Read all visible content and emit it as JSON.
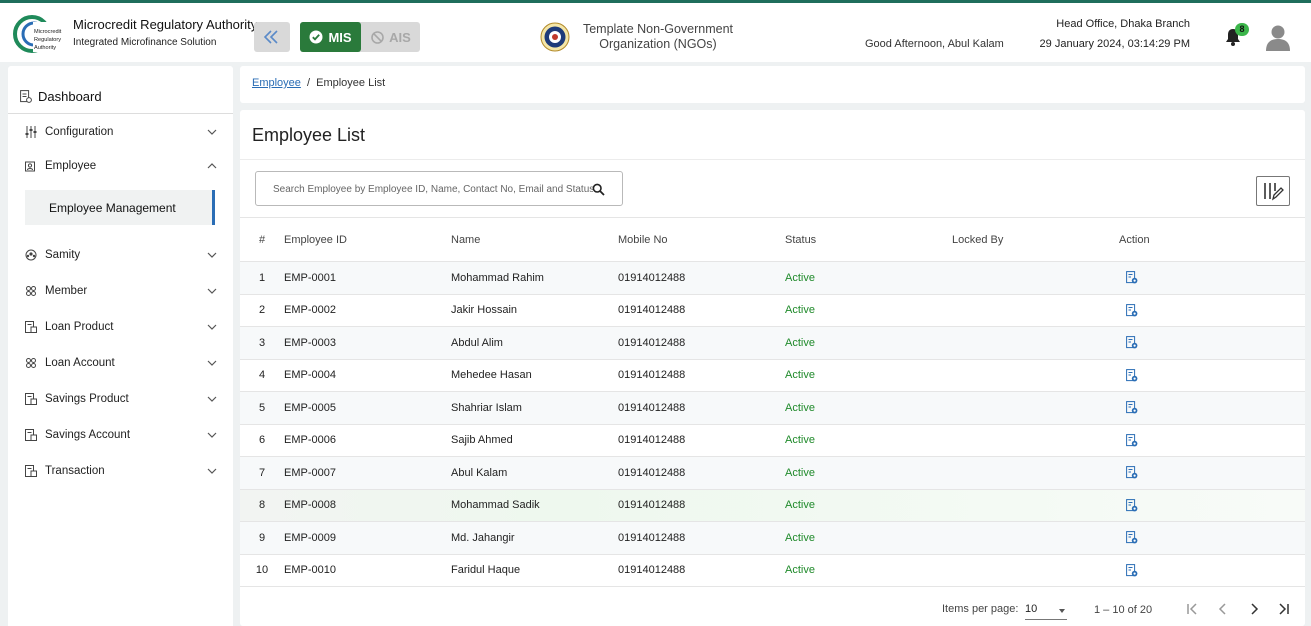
{
  "header": {
    "logo_text": [
      "Microcredit",
      "Regulatory",
      "Authority"
    ],
    "brand_title": "Microcredit Regulatory Authority",
    "brand_subtitle": "Integrated Microfinance Solution",
    "modules": {
      "mis": "MIS",
      "ais": "AIS",
      "active": "MIS"
    },
    "org_line1": "Template Non-Government",
    "org_line2": "Organization (NGOs)",
    "greeting": "Good Afternoon, Abul Kalam",
    "branch": "Head Office, Dhaka Branch",
    "datetime": "29 January 2024, 03:14:29 PM",
    "notification_count": "8",
    "accent_color": "#1f6e5c",
    "icons": [
      "collapse-sidebar-icon",
      "check-circle-icon",
      "ban-icon",
      "org-seal-icon",
      "bell-icon",
      "user-avatar-icon"
    ]
  },
  "sidebar": {
    "dashboard": "Dashboard",
    "items": [
      {
        "label": "Configuration",
        "icon": "sliders-icon",
        "expanded": false
      },
      {
        "label": "Employee",
        "icon": "employee-icon",
        "expanded": true
      },
      {
        "label": "Samity",
        "icon": "group-icon",
        "expanded": false
      },
      {
        "label": "Member",
        "icon": "members-icon",
        "expanded": false
      },
      {
        "label": "Loan Product",
        "icon": "document-icon",
        "expanded": false
      },
      {
        "label": "Loan Account",
        "icon": "members-icon",
        "expanded": false
      },
      {
        "label": "Savings Product",
        "icon": "document-icon",
        "expanded": false
      },
      {
        "label": "Savings Account",
        "icon": "document-icon",
        "expanded": false
      },
      {
        "label": "Transaction",
        "icon": "document-icon",
        "expanded": false
      }
    ],
    "sub_item": "Employee Management"
  },
  "breadcrumb": {
    "parent": "Employee",
    "separator": "/",
    "current": "Employee List"
  },
  "main": {
    "title": "Employee List",
    "search_placeholder": "Search Employee by Employee ID, Name, Contact No, Email and Status",
    "table": {
      "columns": [
        "#",
        "Employee ID",
        "Name",
        "Mobile No",
        "Status",
        "Locked By",
        "Action"
      ],
      "rows": [
        {
          "num": "1",
          "id": "EMP-0001",
          "name": "Mohammad Rahim",
          "mobile": "01914012488",
          "status": "Active",
          "locked_by": ""
        },
        {
          "num": "2",
          "id": "EMP-0002",
          "name": "Jakir Hossain",
          "mobile": "01914012488",
          "status": "Active",
          "locked_by": ""
        },
        {
          "num": "3",
          "id": "EMP-0003",
          "name": "Abdul Alim",
          "mobile": "01914012488",
          "status": "Active",
          "locked_by": ""
        },
        {
          "num": "4",
          "id": "EMP-0004",
          "name": "Mehedee Hasan",
          "mobile": "01914012488",
          "status": "Active",
          "locked_by": ""
        },
        {
          "num": "5",
          "id": "EMP-0005",
          "name": "Shahriar Islam",
          "mobile": "01914012488",
          "status": "Active",
          "locked_by": ""
        },
        {
          "num": "6",
          "id": "EMP-0006",
          "name": "Sajib Ahmed",
          "mobile": "01914012488",
          "status": "Active",
          "locked_by": ""
        },
        {
          "num": "7",
          "id": "EMP-0007",
          "name": "Abul Kalam",
          "mobile": "01914012488",
          "status": "Active",
          "locked_by": ""
        },
        {
          "num": "8",
          "id": "EMP-0008",
          "name": "Mohammad Sadik",
          "mobile": "01914012488",
          "status": "Active",
          "locked_by": ""
        },
        {
          "num": "9",
          "id": "EMP-0009",
          "name": "Md. Jahangir",
          "mobile": "01914012488",
          "status": "Active",
          "locked_by": ""
        },
        {
          "num": "10",
          "id": "EMP-0010",
          "name": "Faridul Haque",
          "mobile": "01914012488",
          "status": "Active",
          "locked_by": ""
        }
      ]
    },
    "pagination": {
      "items_per_page_label": "Items per page:",
      "items_per_page": "10",
      "range": "1 – 10 of 20"
    },
    "status_color": "#1f8a2a",
    "link_color": "#2a6db5"
  }
}
